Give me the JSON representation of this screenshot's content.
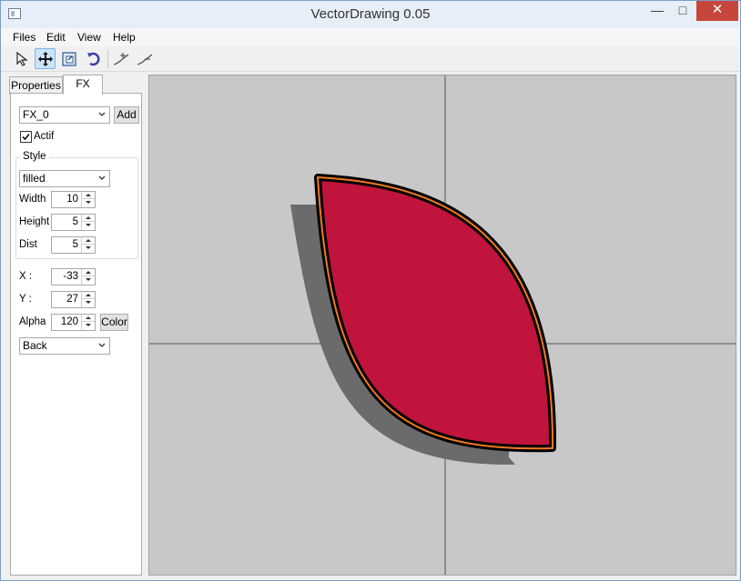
{
  "window": {
    "title": "VectorDrawing 0.05",
    "minimize": "—",
    "maximize": "□",
    "close": "✕"
  },
  "menu": [
    "Files",
    "Edit",
    "View",
    "Help"
  ],
  "toolbar": {
    "tools": [
      {
        "icon": "select-arrow-icon",
        "active": false
      },
      {
        "icon": "move-arrows-icon",
        "active": true
      },
      {
        "icon": "resize-frame-icon",
        "active": false
      },
      {
        "icon": "rotate-icon",
        "active": false
      },
      {
        "icon": "add-point-curve-icon",
        "active": false
      },
      {
        "icon": "remove-point-curve-icon",
        "active": false
      }
    ]
  },
  "tabs": [
    {
      "label": "Properties",
      "selected": false
    },
    {
      "label": "FX",
      "selected": true
    }
  ],
  "fx": {
    "effect_select": "FX_0",
    "add_button": "Add",
    "actif_label": "Actif",
    "actif_checked": true,
    "style_group_title": "Style",
    "style_select": "filled",
    "width_label": "Width",
    "width_value": "10",
    "height_label": "Height",
    "height_value": "5",
    "dist_label": "Dist",
    "dist_value": "5",
    "x_label": "X :",
    "x_value": "-33",
    "y_label": "Y :",
    "y_value": "27",
    "alpha_label": "Alpha",
    "alpha_value": "120",
    "color_button": "Color",
    "layer_select": "Back"
  },
  "colors": {
    "canvas_bg": "#c8c8c8",
    "shape_fill": "#c0143c",
    "shape_outline": "#000000",
    "shape_inner_stroke": "#f07a1e",
    "shadow": "#6b6b6b",
    "axis": "#555555"
  }
}
